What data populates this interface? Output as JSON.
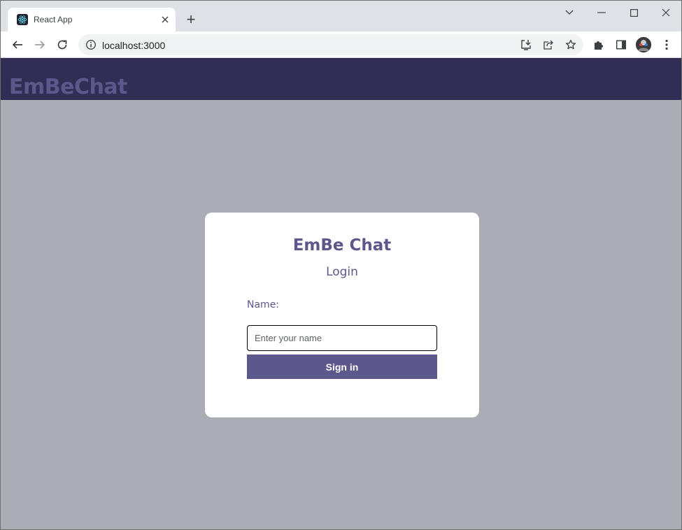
{
  "browser": {
    "tab": {
      "title": "React App",
      "favicon": "react-logo-icon"
    },
    "new_tab_symbol": "+",
    "url": "localhost:3000",
    "colors": {
      "tabstrip": "#dee1e6",
      "toolbar": "#ffffff"
    }
  },
  "app": {
    "brand": "EmBeChat",
    "colors": {
      "header": "#312d55",
      "accent": "#5d588b",
      "background": "#aaadb4",
      "card": "#ffffff"
    }
  },
  "login": {
    "title": "EmBe Chat",
    "subtitle": "Login",
    "name_label": "Name:",
    "name_placeholder": "Enter your name",
    "name_value": "",
    "signin_label": "Sign in"
  }
}
